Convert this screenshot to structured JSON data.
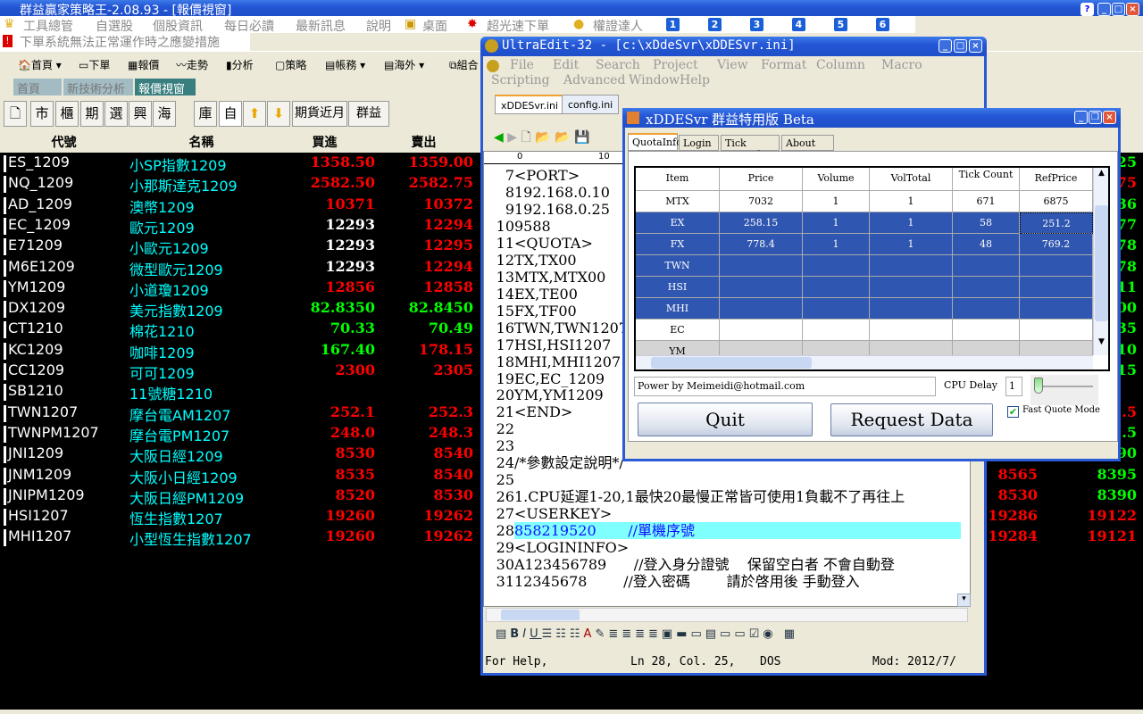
{
  "main_window": {
    "title": "群益贏家策略王-2.08.93 - [報價視窗]"
  },
  "menu": {
    "items": [
      "工具總管",
      "自選股",
      "個股資訊",
      "每日必讀",
      "最新訊息",
      "說明",
      "桌面",
      "超光速下單",
      "權證達人"
    ],
    "numbers": [
      "1",
      "2",
      "3",
      "4",
      "5",
      "6"
    ]
  },
  "notice": "下單系統無法正常運作時之應變措施",
  "toolbar": [
    "首頁",
    "下單",
    "報價",
    "走勢",
    "分析",
    "策略",
    "帳務",
    "海外",
    "組合"
  ],
  "tabs": [
    "首頁",
    "新技術分析",
    "報價視窗"
  ],
  "buttons": [
    "市",
    "櫃",
    "期",
    "選",
    "興",
    "海",
    "庫",
    "自",
    "期貨近月",
    "群益"
  ],
  "quote_table": {
    "headers": [
      "代號",
      "名稱",
      "買進",
      "賣出"
    ],
    "colors": {
      "red": "#ff0000",
      "green": "#00ff00",
      "white": "#ffffff",
      "cyan": "#00ffff"
    },
    "rows": [
      {
        "code": "ES_1209",
        "name": "小SP指數1209",
        "bid": "1358.50",
        "ask": "1359.00",
        "bc": "#ff0000",
        "ac": "#ff0000",
        "r1": "",
        "r2": "25",
        "r2c": "#00ff00"
      },
      {
        "code": "NQ_1209",
        "name": "小那斯達克1209",
        "bid": "2582.50",
        "ask": "2582.75",
        "bc": "#ff0000",
        "ac": "#ff0000",
        "r1": "",
        "r2": "75",
        "r2c": "#ff0000"
      },
      {
        "code": "AD_1209",
        "name": "澳幣1209",
        "bid": "10371",
        "ask": "10372",
        "bc": "#ff0000",
        "ac": "#ff0000",
        "r1": "",
        "r2": "36",
        "r2c": "#00ff00"
      },
      {
        "code": "EC_1209",
        "name": "歐元1209",
        "bid": "12293",
        "ask": "12294",
        "bc": "#ffffff",
        "ac": "#ff0000",
        "r1": "",
        "r2": "77",
        "r2c": "#00ff00"
      },
      {
        "code": "E71209",
        "name": "小歐元1209",
        "bid": "12293",
        "ask": "12295",
        "bc": "#ffffff",
        "ac": "#ff0000",
        "r1": "",
        "r2": "78",
        "r2c": "#00ff00"
      },
      {
        "code": "M6E1209",
        "name": "微型歐元1209",
        "bid": "12293",
        "ask": "12294",
        "bc": "#ffffff",
        "ac": "#ff0000",
        "r1": "",
        "r2": "78",
        "r2c": "#00ff00"
      },
      {
        "code": "YM1209",
        "name": "小道瓊1209",
        "bid": "12856",
        "ask": "12858",
        "bc": "#ff0000",
        "ac": "#ff0000",
        "r1": "",
        "r2": "11",
        "r2c": "#00ff00"
      },
      {
        "code": "DX1209",
        "name": "美元指數1209",
        "bid": "82.8350",
        "ask": "82.8450",
        "bc": "#00ff00",
        "ac": "#00ff00",
        "r1": "",
        "r2": "00",
        "r2c": "#00ff00"
      },
      {
        "code": "CT1210",
        "name": "棉花1210",
        "bid": "70.33",
        "ask": "70.49",
        "bc": "#00ff00",
        "ac": "#00ff00",
        "r1": "",
        "r2": "35",
        "r2c": "#00ff00"
      },
      {
        "code": "KC1209",
        "name": "咖啡1209",
        "bid": "167.40",
        "ask": "178.15",
        "bc": "#00ff00",
        "ac": "#ff0000",
        "r1": "",
        "r2": "10",
        "r2c": "#00ff00"
      },
      {
        "code": "CC1209",
        "name": "可可1209",
        "bid": "2300",
        "ask": "2305",
        "bc": "#ff0000",
        "ac": "#ff0000",
        "r1": "",
        "r2": "15",
        "r2c": "#00ff00"
      },
      {
        "code": "SB1210",
        "name": "11號糖1210",
        "bid": "",
        "ask": "",
        "bc": "#ff0000",
        "ac": "#ff0000",
        "r1": "",
        "r2": "",
        "r2c": "#00ff00"
      },
      {
        "code": "TWN1207",
        "name": "摩台電AM1207",
        "bid": "252.1",
        "ask": "252.3",
        "bc": "#ff0000",
        "ac": "#ff0000",
        "r1": "",
        "r2": ".5",
        "r2c": "#ff0000"
      },
      {
        "code": "TWNPM1207",
        "name": "摩台電PM1207",
        "bid": "248.0",
        "ask": "248.3",
        "bc": "#ff0000",
        "ac": "#ff0000",
        "r1": "",
        "r2": ".5",
        "r2c": "#00ff00"
      },
      {
        "code": "JNI1209",
        "name": "大阪日經1209",
        "bid": "8530",
        "ask": "8540",
        "bc": "#ff0000",
        "ac": "#ff0000",
        "r1": "",
        "r2": "90",
        "r2c": "#00ff00"
      },
      {
        "code": "JNM1209",
        "name": "大阪小日經1209",
        "bid": "8535",
        "ask": "8540",
        "bc": "#ff0000",
        "ac": "#ff0000",
        "r1": "8565",
        "r1c": "#ff0000",
        "r2": "8395",
        "r2c": "#00ff00"
      },
      {
        "code": "JNIPM1209",
        "name": "大阪日經PM1209",
        "bid": "8520",
        "ask": "8530",
        "bc": "#ff0000",
        "ac": "#ff0000",
        "r1": "8530",
        "r1c": "#ff0000",
        "r2": "8390",
        "r2c": "#00ff00"
      },
      {
        "code": "HSI1207",
        "name": "恆生指數1207",
        "bid": "19260",
        "ask": "19262",
        "bc": "#ff0000",
        "ac": "#ff0000",
        "r1": "19286",
        "r1c": "#ff0000",
        "r2": "19122",
        "r2c": "#ff0000"
      },
      {
        "code": "MHI1207",
        "name": "小型恆生指數1207",
        "bid": "19260",
        "ask": "19262",
        "bc": "#ff0000",
        "ac": "#ff0000",
        "r1": "19284",
        "r1c": "#ff0000",
        "r2": "19121",
        "r2c": "#ff0000"
      }
    ]
  },
  "ultraedit": {
    "title": "UltraEdit-32 - [c:\\xDdeSvr\\xDDESvr.ini]",
    "menu_row1": [
      "File",
      "Edit",
      "Search",
      "Project",
      "View",
      "Format",
      "Column",
      "Macro"
    ],
    "menu_row2": [
      "Scripting",
      "Advanced",
      "Window",
      "Help"
    ],
    "tabs": [
      "xDDESvr.ini",
      "config.ini"
    ],
    "ruler": [
      "0",
      "10"
    ],
    "lines": [
      {
        "n": "7",
        "t": "<PORT>"
      },
      {
        "n": "8",
        "t": "192.168.0.10"
      },
      {
        "n": "9",
        "t": "192.168.0.25"
      },
      {
        "n": "10",
        "t": "9588"
      },
      {
        "n": "11",
        "t": "<QUOTA>"
      },
      {
        "n": "12",
        "t": "TX,TX00"
      },
      {
        "n": "13",
        "t": "MTX,MTX00"
      },
      {
        "n": "14",
        "t": "EX,TE00"
      },
      {
        "n": "15",
        "t": "FX,TF00"
      },
      {
        "n": "16",
        "t": "TWN,TWN1207"
      },
      {
        "n": "17",
        "t": "HSI,HSI1207"
      },
      {
        "n": "18",
        "t": "MHI,MHI1207"
      },
      {
        "n": "19",
        "t": "EC,EC_1209"
      },
      {
        "n": "20",
        "t": "YM,YM1209"
      },
      {
        "n": "21",
        "t": "<END>"
      },
      {
        "n": "22",
        "t": ""
      },
      {
        "n": "23",
        "t": ""
      },
      {
        "n": "24",
        "t": "/*參數設定說明*/"
      },
      {
        "n": "25",
        "t": ""
      },
      {
        "n": "26",
        "t": "1.CPU延遲1-20,1最快20最慢正常皆可使用1負載不了再往上"
      },
      {
        "n": "27",
        "t": "<USERKEY>"
      },
      {
        "n": "28",
        "t": "858219520       //單機序號"
      },
      {
        "n": "29",
        "t": "<LOGININFO>"
      },
      {
        "n": "30",
        "t": "A123456789      //登入身分證號    保留空白者 不會自動登"
      },
      {
        "n": "31",
        "t": "12345678        //登入密碼        請於啓用後 手動登入"
      }
    ],
    "highlighted_line": "28",
    "status": {
      "help": "For Help,",
      "position": "Ln 28, Col. 25,",
      "format": "DOS",
      "modified": "Mod: 2012/7/"
    }
  },
  "xddesvr": {
    "title": "xDDESvr  群益特用版 Beta",
    "tabs": [
      "QuotaInfo",
      "Login",
      "Tick Record",
      "About Me"
    ],
    "columns": [
      "Item",
      "Price",
      "Volume",
      "VolTotal",
      "Tick Count",
      "RefPrice"
    ],
    "rows": [
      {
        "item": "MTX",
        "price": "7032",
        "volume": "1",
        "voltotal": "1",
        "tick": "671",
        "ref": "6875",
        "state": "normal"
      },
      {
        "item": "EX",
        "price": "258.15",
        "volume": "1",
        "voltotal": "1",
        "tick": "58",
        "ref": "251.2",
        "state": "selected"
      },
      {
        "item": "FX",
        "price": "778.4",
        "volume": "1",
        "voltotal": "1",
        "tick": "48",
        "ref": "769.2",
        "state": "selected"
      },
      {
        "item": "TWN",
        "price": "",
        "volume": "",
        "voltotal": "",
        "tick": "",
        "ref": "",
        "state": "selected"
      },
      {
        "item": "HSI",
        "price": "",
        "volume": "",
        "voltotal": "",
        "tick": "",
        "ref": "",
        "state": "selected"
      },
      {
        "item": "MHI",
        "price": "",
        "volume": "",
        "voltotal": "",
        "tick": "",
        "ref": "",
        "state": "selected"
      },
      {
        "item": "EC",
        "price": "",
        "volume": "",
        "voltotal": "",
        "tick": "",
        "ref": "",
        "state": "normal"
      },
      {
        "item": "YM",
        "price": "",
        "volume": "",
        "voltotal": "",
        "tick": "",
        "ref": "",
        "state": "gray"
      }
    ],
    "power_by": "Power by Meimeidi@hotmail.com",
    "cpu_delay_label": "CPU Delay",
    "cpu_delay_value": "1",
    "slider_level": 1,
    "quit": "Quit",
    "request": "Request Data",
    "fast_quote_label": "Fast Quote Mode",
    "fast_quote_checked": true
  }
}
